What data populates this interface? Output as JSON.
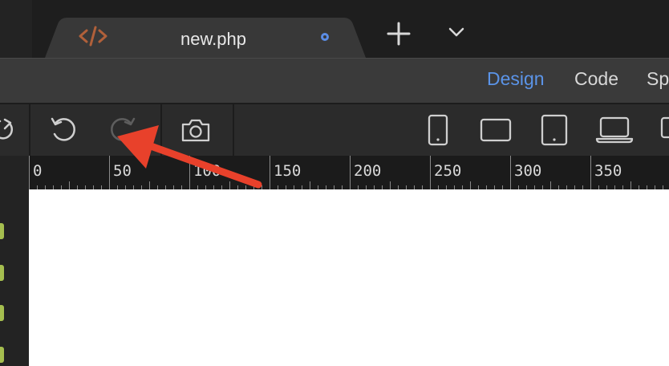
{
  "tab": {
    "title": "new.php",
    "file_icon": "code-icon",
    "status": "unsaved-dot"
  },
  "tabbar_actions": [
    {
      "icon": "plus-icon"
    },
    {
      "icon": "chevron-down-icon"
    }
  ],
  "modes": [
    {
      "label": "Design",
      "active": true
    },
    {
      "label": "Code",
      "active": false
    },
    {
      "label": "Sp",
      "active": false
    }
  ],
  "toolbar": {
    "refresh_icon": "refresh-icon",
    "undo_icon": "undo-icon",
    "redo_icon": "redo-icon",
    "screenshot_icon": "camera-icon",
    "devices": [
      {
        "icon": "phone-icon"
      },
      {
        "icon": "phone-landscape-icon"
      },
      {
        "icon": "tablet-icon"
      },
      {
        "icon": "laptop-icon"
      },
      {
        "icon": "desktop-icon"
      }
    ]
  },
  "ruler": {
    "labels": [
      "0",
      "50",
      "100",
      "150",
      "200",
      "250",
      "300",
      "350"
    ]
  },
  "colors": {
    "accent": "#5b94e8",
    "annotation_arrow": "#e8412b",
    "tab_icon": "#b0603a",
    "panel_marker": "#a5be4f"
  },
  "annotation": {
    "type": "arrow",
    "target": "redo-icon"
  }
}
